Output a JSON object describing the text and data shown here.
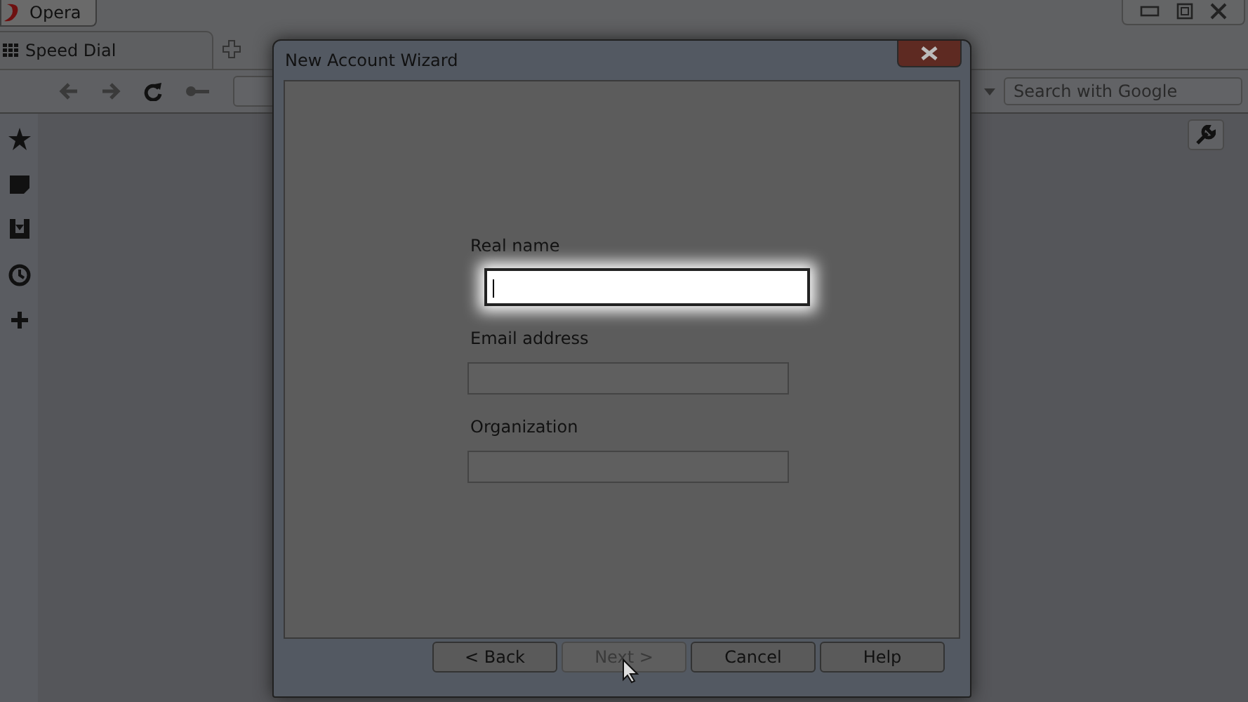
{
  "menu_button": {
    "label": "Opera"
  },
  "tabs": [
    {
      "label": "Speed Dial",
      "selected": true
    }
  ],
  "search": {
    "placeholder": "Search with Google"
  },
  "dialog": {
    "title": "New Account Wizard",
    "fields": [
      {
        "label": "Real name",
        "focused": true
      },
      {
        "label": "Email address",
        "focused": false
      },
      {
        "label": "Organization",
        "focused": false
      }
    ],
    "buttons": [
      {
        "label": "< Back",
        "disabled": false
      },
      {
        "label": "Next >",
        "disabled": true
      },
      {
        "label": "Cancel",
        "disabled": false
      },
      {
        "label": "Help",
        "disabled": false
      }
    ]
  }
}
